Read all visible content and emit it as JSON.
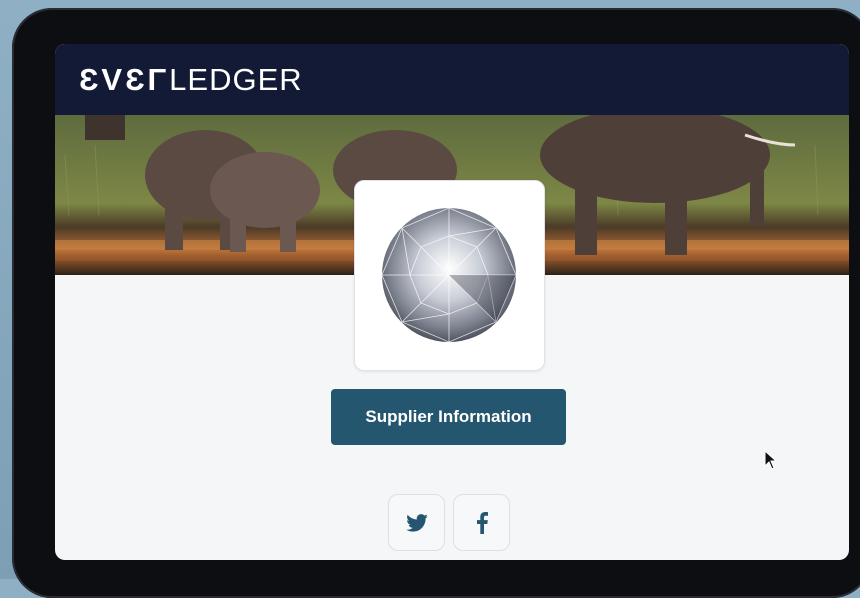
{
  "header": {
    "logo_mark": "ƐVƐΓ",
    "logo_word": "LEDGER"
  },
  "banner": {
    "icon": "elephants-photo"
  },
  "product": {
    "icon": "diamond-image"
  },
  "supplier_button": {
    "label": "Supplier Information"
  },
  "social": [
    {
      "icon": "twitter-icon",
      "glyph": "🐦"
    },
    {
      "icon": "facebook-icon",
      "glyph": "f"
    }
  ],
  "colors": {
    "header_bg": "#121a36",
    "button_bg": "#24566f",
    "page_bg": "#f5f6f8"
  }
}
